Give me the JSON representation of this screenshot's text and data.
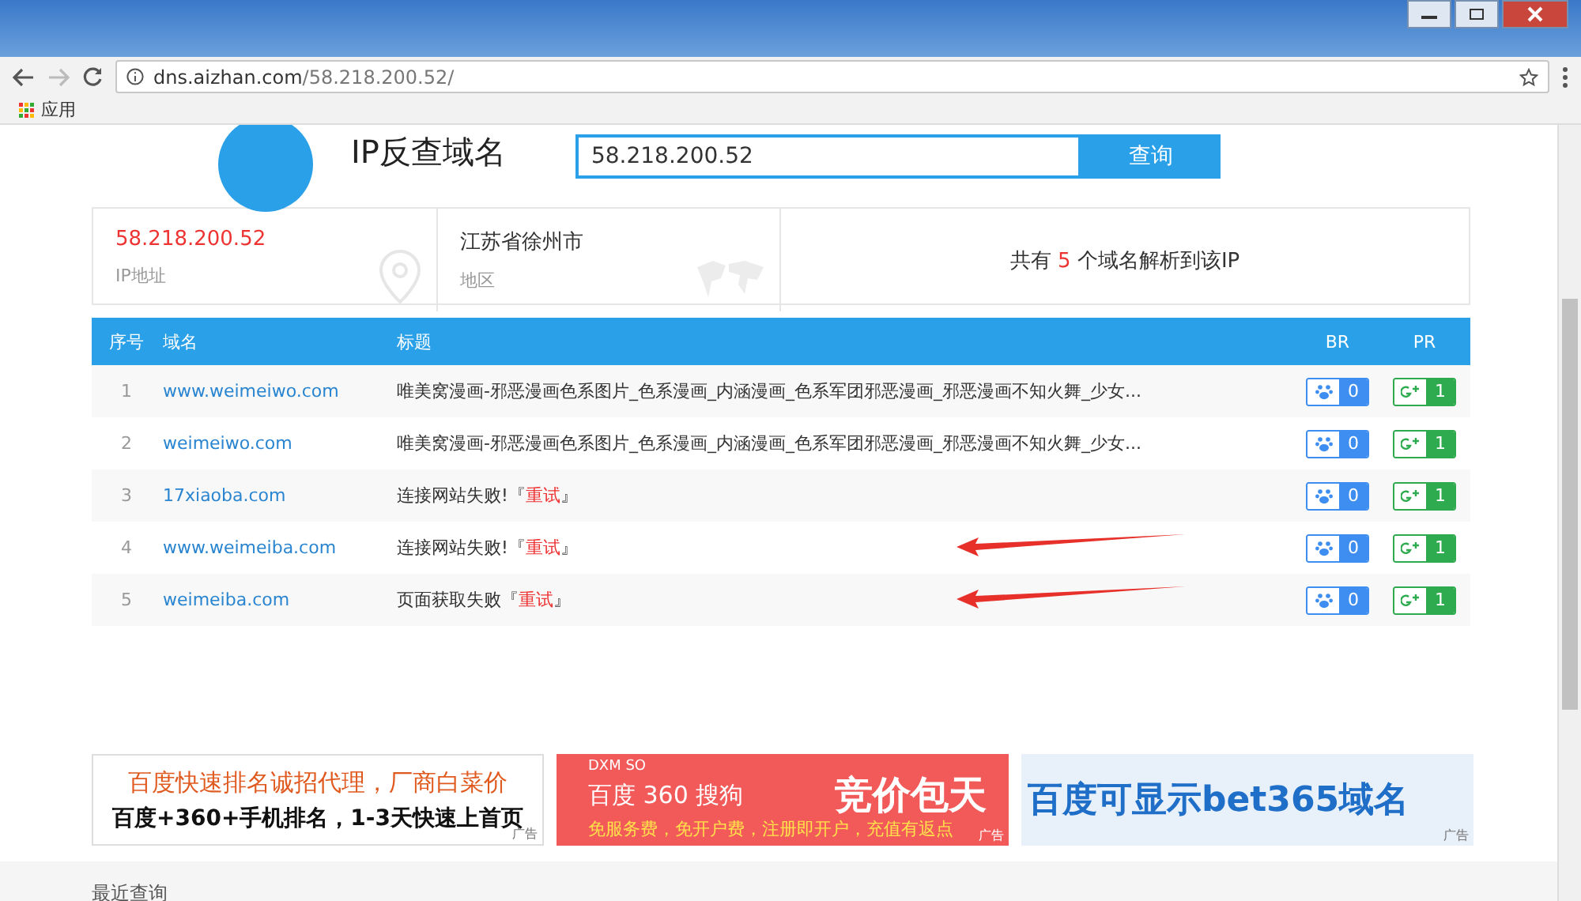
{
  "browser": {
    "address_host": "dns.aizhan.com",
    "address_path": "/58.218.200.52/",
    "bookmarks": [
      {
        "label": "应用"
      }
    ]
  },
  "header": {
    "title": "IP反查域名",
    "search_value": "58.218.200.52",
    "search_button": "查询"
  },
  "info": [
    {
      "value": "58.218.200.52",
      "label": "IP地址",
      "kind": "ip"
    },
    {
      "value": "江苏省徐州市",
      "label": "地区",
      "kind": "region"
    }
  ],
  "summary": {
    "prefix": "共有",
    "count": "5",
    "suffix": "个域名解析到该IP"
  },
  "table": {
    "columns": [
      "序号",
      "域名",
      "标题",
      "BR",
      "PR"
    ],
    "rows": [
      {
        "index": "1",
        "domain": "www.weimeiwo.com",
        "title": "唯美窝漫画-邪恶漫画色系图片_色系漫画_内涵漫画_色系军团邪恶漫画_邪恶漫画不知火舞_少女...",
        "br": "0",
        "pr": "1",
        "annotated": false
      },
      {
        "index": "2",
        "domain": "weimeiwo.com",
        "title": "唯美窝漫画-邪恶漫画色系图片_色系漫画_内涵漫画_色系军团邪恶漫画_邪恶漫画不知火舞_少女...",
        "br": "0",
        "pr": "1",
        "annotated": false
      },
      {
        "index": "3",
        "domain": "17xiaoba.com",
        "title": "连接网站失败!",
        "retry": {
          "before": "『",
          "link": "重试",
          "after": "』"
        },
        "br": "0",
        "pr": "1",
        "annotated": false
      },
      {
        "index": "4",
        "domain": "www.weimeiba.com",
        "title": "连接网站失败!",
        "retry": {
          "before": "『",
          "link": "重试",
          "after": "』"
        },
        "br": "0",
        "pr": "1",
        "annotated": true
      },
      {
        "index": "5",
        "domain": "weimeiba.com",
        "title": "页面获取失败",
        "retry": {
          "before": "『",
          "link": "重试",
          "after": "』"
        },
        "br": "0",
        "pr": "1",
        "annotated": true
      }
    ]
  },
  "ads": [
    {
      "kind": "white",
      "headline": "百度快速排名诚招代理，厂商白菜价",
      "subline": "百度+360+手机排名，1-3天快速上首页",
      "tag": "广告"
    },
    {
      "kind": "red",
      "brand": "DXM SO",
      "headline": "百度 360 搜狗",
      "slogan": "竞价包天",
      "subline": "免服务费，免开户费，注册即开户，充值有返点",
      "tag": "广告"
    },
    {
      "kind": "blue",
      "headline": "百度可显示bet365域名",
      "tag": "广告"
    }
  ],
  "recent": {
    "title": "最近查询"
  }
}
